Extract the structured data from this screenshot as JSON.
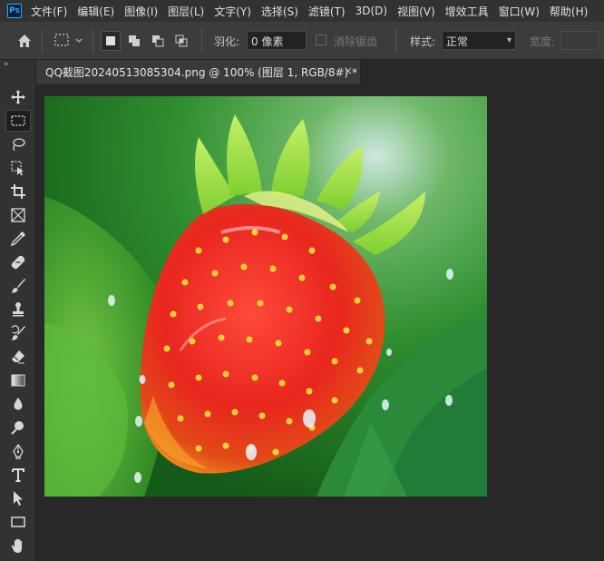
{
  "app": {
    "logo_text": "Ps"
  },
  "menu": {
    "items": [
      "文件(F)",
      "编辑(E)",
      "图像(I)",
      "图层(L)",
      "文字(Y)",
      "选择(S)",
      "滤镜(T)",
      "3D(D)",
      "视图(V)",
      "增效工具",
      "窗口(W)",
      "帮助(H)"
    ]
  },
  "options": {
    "feather_label": "羽化:",
    "feather_value": "0 像素",
    "antialias_label": "消除锯齿",
    "style_label": "样式:",
    "style_value": "正常",
    "width_label": "宽度:"
  },
  "document": {
    "tab_title": "QQ截图20240513085304.png @ 100% (图层 1, RGB/8#) *",
    "close_glyph": "×"
  },
  "tools": [
    "move-tool",
    "rectangular-marquee-tool",
    "lasso-tool",
    "object-selection-tool",
    "crop-tool",
    "frame-tool",
    "eyedropper-tool",
    "healing-brush-tool",
    "brush-tool",
    "clone-stamp-tool",
    "history-brush-tool",
    "eraser-tool",
    "gradient-tool",
    "blur-tool",
    "dodge-tool",
    "pen-tool",
    "type-tool",
    "path-selection-tool",
    "rectangle-tool",
    "hand-tool"
  ],
  "colors": {
    "menubar": "#323232",
    "optionsbar": "#3c3c3c",
    "workspace": "#282828",
    "accent": "#31a8ff"
  }
}
